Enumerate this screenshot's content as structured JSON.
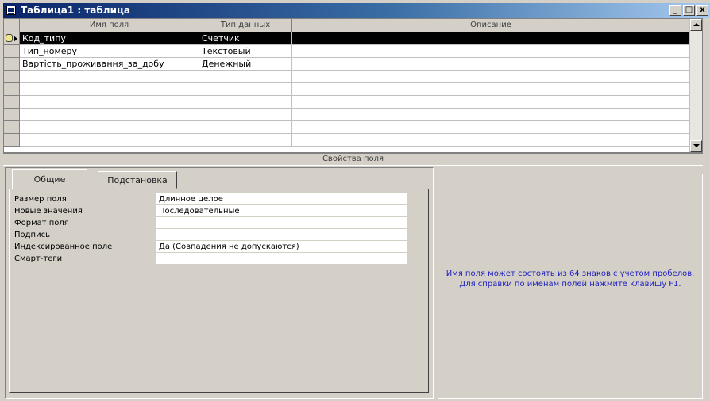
{
  "window": {
    "title": "Таблица1 : таблица",
    "buttons": [
      "_",
      "□",
      "x"
    ]
  },
  "grid": {
    "columns": [
      "Имя поля",
      "Тип данных",
      "Описание"
    ],
    "rows": [
      {
        "name": "Код_типу",
        "type": "Счетчик",
        "desc": "",
        "key": true,
        "active": true
      },
      {
        "name": "Тип_номеру",
        "type": "Текстовый",
        "desc": "",
        "key": false,
        "active": false
      },
      {
        "name": "Вартість_проживання_за_добу",
        "type": "Денежный",
        "desc": "",
        "key": false,
        "active": false
      },
      {
        "name": "",
        "type": "",
        "desc": ""
      },
      {
        "name": "",
        "type": "",
        "desc": ""
      },
      {
        "name": "",
        "type": "",
        "desc": ""
      },
      {
        "name": "",
        "type": "",
        "desc": ""
      },
      {
        "name": "",
        "type": "",
        "desc": ""
      },
      {
        "name": "",
        "type": "",
        "desc": ""
      }
    ]
  },
  "properties_bar": "Свойства поля",
  "tabs": [
    "Общие",
    "Подстановка"
  ],
  "properties": [
    {
      "label": "Размер поля",
      "value": "Длинное целое"
    },
    {
      "label": "Новые значения",
      "value": "Последовательные"
    },
    {
      "label": "Формат поля",
      "value": ""
    },
    {
      "label": "Подпись",
      "value": ""
    },
    {
      "label": "Индексированное поле",
      "value": "Да (Совпадения не допускаются)"
    },
    {
      "label": "Смарт-теги",
      "value": ""
    }
  ],
  "hint": "Имя поля может состоять из 64 знаков с учетом пробелов.  Для справки по именам полей нажмите клавишу F1."
}
